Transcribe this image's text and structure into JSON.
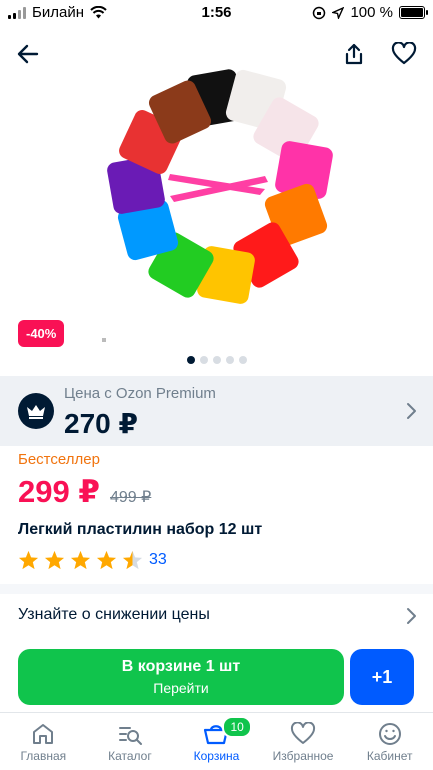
{
  "status_bar": {
    "carrier": "Билайн",
    "time": "1:56",
    "battery": "100 %",
    "battery_level": 1.0
  },
  "colors": {
    "accent": "#005bff",
    "sale": "#f91155",
    "cart_green": "#10c44c",
    "bestseller": "#f1740f"
  },
  "icons": {
    "back": "arrow-left-icon",
    "share": "share-icon",
    "favorite": "heart-icon",
    "premium": "crown-icon"
  },
  "product": {
    "discount_badge": "-40%",
    "gallery_total": 5,
    "gallery_active": 1,
    "premium_label": "Цена с Ozon Premium",
    "premium_price": "270 ₽",
    "bestseller": "Бестселлер",
    "price": "299 ₽",
    "old_price": "499 ₽",
    "title": "Легкий пластилин набор 12 шт",
    "rating": 4.5,
    "reviews_count": "33"
  },
  "price_alert": {
    "label": "Узнайте о снижении цены"
  },
  "cart": {
    "in_cart_label": "В корзине 1 шт",
    "go_label": "Перейти",
    "plus_label": "+1"
  },
  "tabbar": {
    "items": [
      {
        "label": "Главная",
        "icon": "home-icon"
      },
      {
        "label": "Каталог",
        "icon": "catalog-icon"
      },
      {
        "label": "Корзина",
        "icon": "cart-icon",
        "badge": "10",
        "active": true
      },
      {
        "label": "Избранное",
        "icon": "heart-icon"
      },
      {
        "label": "Кабинет",
        "icon": "profile-icon"
      }
    ]
  }
}
